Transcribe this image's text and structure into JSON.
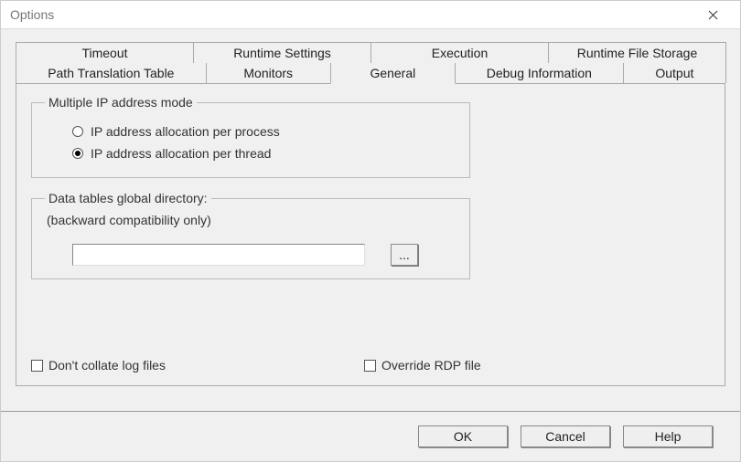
{
  "window": {
    "title": "Options"
  },
  "tabs": {
    "row1": [
      "Timeout",
      "Runtime Settings",
      "Execution",
      "Runtime File Storage"
    ],
    "row2": [
      "Path Translation Table",
      "Monitors",
      "General",
      "Debug Information",
      "Output"
    ],
    "active": "General"
  },
  "ip_group": {
    "legend": "Multiple IP address mode",
    "opt_process": "IP address allocation per process",
    "opt_thread": "IP address allocation per thread",
    "selected": "thread"
  },
  "dt_group": {
    "legend": "Data tables global directory:",
    "sub": "(backward compatibility only)",
    "value": "",
    "browse_label": "..."
  },
  "checks": {
    "collate": {
      "label": "Don't collate log files",
      "checked": false
    },
    "override_rdp": {
      "label": "Override RDP file",
      "checked": false
    }
  },
  "buttons": {
    "ok": "OK",
    "cancel": "Cancel",
    "help": "Help"
  }
}
